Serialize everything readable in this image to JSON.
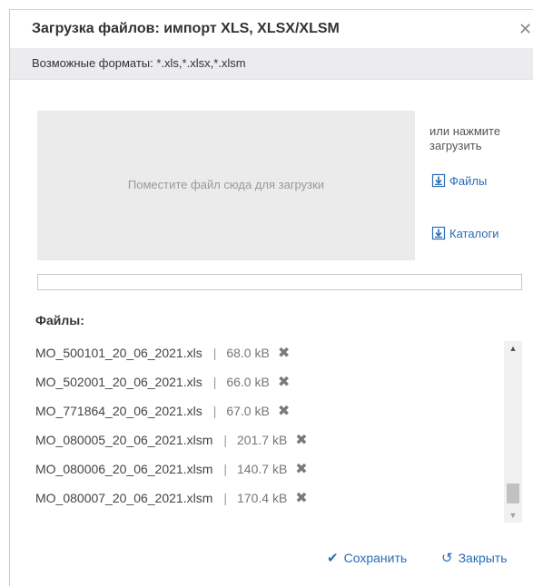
{
  "dialog": {
    "title": "Загрузка файлов: импорт XLS, XLSX/XLSM",
    "close_glyph": "✕",
    "formats": "Возможные форматы: *.xls,*.xlsx,*.xlsm"
  },
  "dropzone": {
    "text": "Поместите файл сюда для загрузки"
  },
  "side": {
    "hint": "или нажмите загрузить",
    "files_label": "Файлы",
    "catalogs_label": "Каталоги",
    "icon": "download-icon"
  },
  "progress": {
    "value": 0
  },
  "files": {
    "heading": "Файлы:",
    "separator": "|",
    "remove_glyph": "✖",
    "items": [
      {
        "name": "MO_500101_20_06_2021.xls",
        "size": "68.0 kB"
      },
      {
        "name": "MO_502001_20_06_2021.xls",
        "size": "66.0 kB"
      },
      {
        "name": "MO_771864_20_06_2021.xls",
        "size": "67.0 kB"
      },
      {
        "name": "MO_080005_20_06_2021.xlsm",
        "size": "201.7 kB"
      },
      {
        "name": "MO_080006_20_06_2021.xlsm",
        "size": "140.7 kB"
      },
      {
        "name": "MO_080007_20_06_2021.xlsm",
        "size": "170.4 kB"
      }
    ]
  },
  "scrollbar": {
    "up_glyph": "▲",
    "down_glyph": "▼"
  },
  "footer": {
    "save_label": "Сохранить",
    "save_glyph": "✔",
    "close_label": "Закрыть",
    "close_glyph": "↺"
  },
  "colors": {
    "accent": "#2a6db5",
    "formats_bar": "#ececee",
    "dropzone": "#ebebeb"
  }
}
